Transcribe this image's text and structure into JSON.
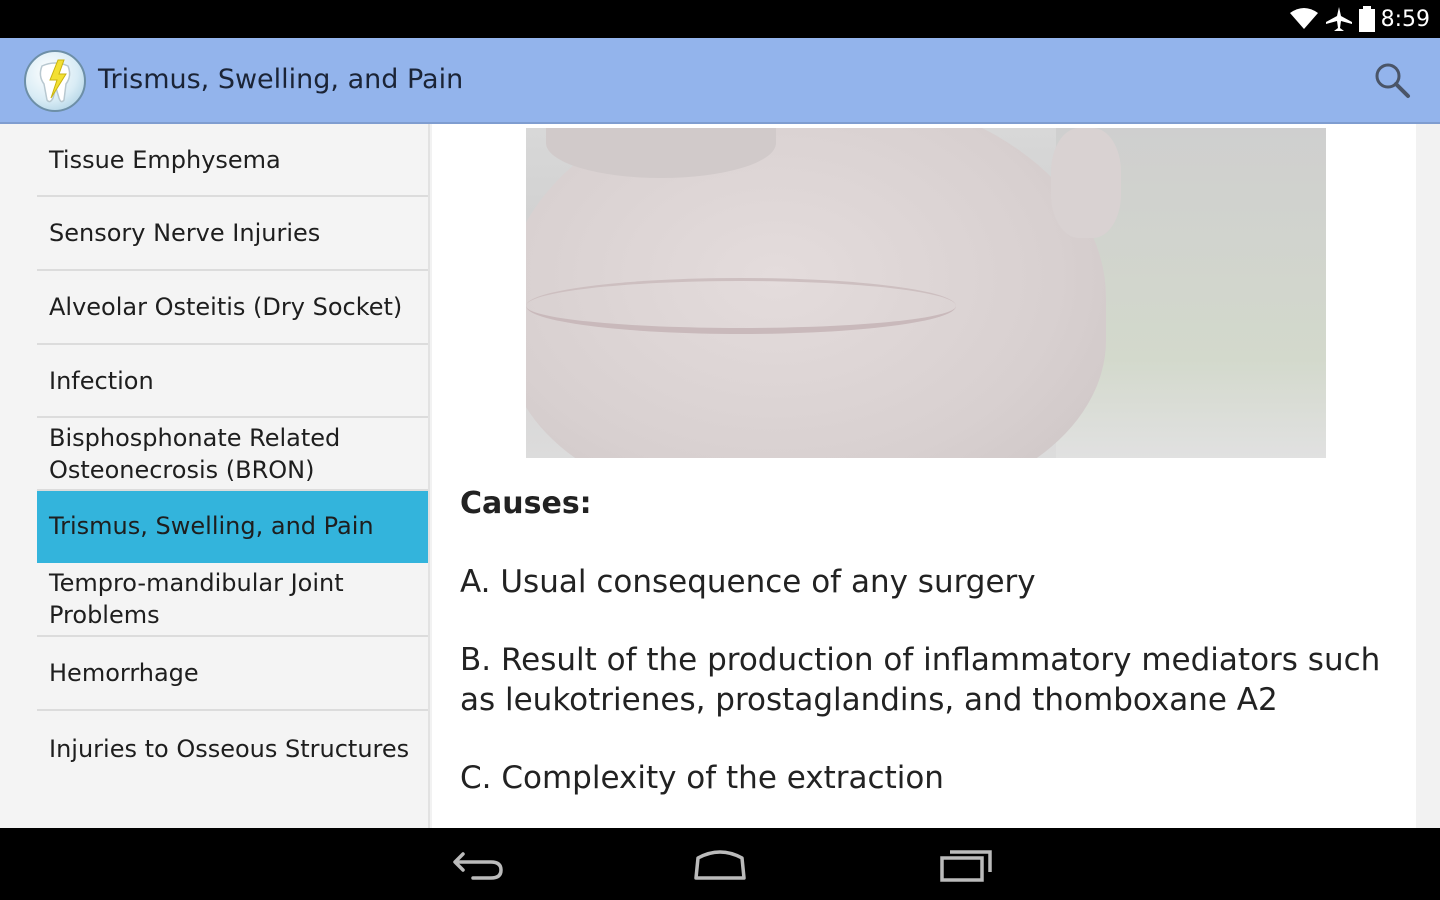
{
  "status_bar": {
    "time": "8:59",
    "icons": [
      "wifi-icon",
      "airplane-icon",
      "battery-icon"
    ]
  },
  "action_bar": {
    "title": "Trismus, Swelling, and Pain",
    "app_icon": "tooth-logo-icon",
    "search_icon": "search-icon"
  },
  "sidebar": {
    "items": [
      {
        "label": "Tissue Emphysema"
      },
      {
        "label": "Sensory Nerve Injuries"
      },
      {
        "label": "Alveolar Osteitis (Dry Socket)"
      },
      {
        "label": "Infection"
      },
      {
        "label": "Bisphosphonate Related Osteonecrosis (BRON)"
      },
      {
        "label": "Trismus, Swelling, and Pain",
        "selected": true
      },
      {
        "label": "Tempro-mandibular Joint Problems"
      },
      {
        "label": "Hemorrhage"
      },
      {
        "label": "Injuries to Osseous Structures"
      }
    ]
  },
  "detail": {
    "heading": "Causes:",
    "causes": [
      "A. Usual consequence of any surgery",
      "B. Result of the production of inflammatory mediators such as leukotrienes, prostaglandins, and thomboxane A2",
      "C. Complexity of the extraction"
    ]
  },
  "nav_bar": {
    "icons": [
      "back-icon",
      "home-icon",
      "recents-icon"
    ]
  },
  "colors": {
    "action_bar": "#93b4ec",
    "selected_item": "#33b4dc"
  }
}
